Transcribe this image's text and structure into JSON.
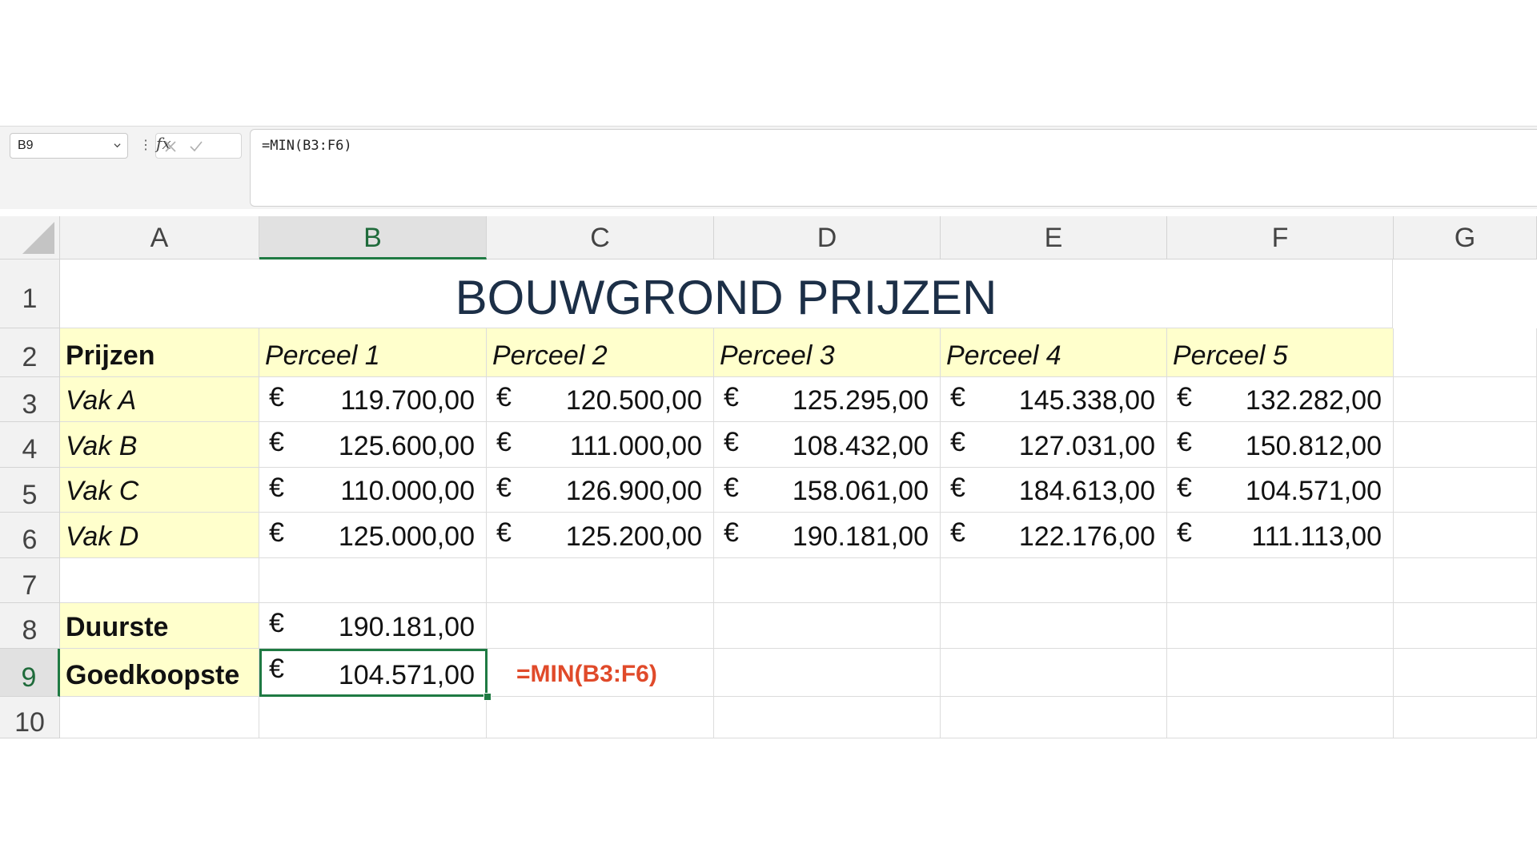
{
  "formula_bar": {
    "name_box": "B9",
    "formula": "=MIN(B3:F6)",
    "fx_label": "fx"
  },
  "columns": [
    "A",
    "B",
    "C",
    "D",
    "E",
    "F",
    "G"
  ],
  "selected_column": "B",
  "rows": [
    "1",
    "2",
    "3",
    "4",
    "5",
    "6",
    "7",
    "8",
    "9",
    "10"
  ],
  "selected_row": "9",
  "sheet": {
    "title": "BOUWGROND PRIJZEN",
    "header": {
      "label": "Prijzen",
      "parcels": [
        "Perceel 1",
        "Perceel 2",
        "Perceel 3",
        "Perceel 4",
        "Perceel 5"
      ]
    },
    "currency": "€",
    "data_rows": [
      {
        "label": "Vak A",
        "values": [
          "119.700,00",
          "120.500,00",
          "125.295,00",
          "145.338,00",
          "132.282,00"
        ]
      },
      {
        "label": "Vak B",
        "values": [
          "125.600,00",
          "111.000,00",
          "108.432,00",
          "127.031,00",
          "150.812,00"
        ]
      },
      {
        "label": "Vak C",
        "values": [
          "110.000,00",
          "126.900,00",
          "158.061,00",
          "184.613,00",
          "104.571,00"
        ]
      },
      {
        "label": "Vak D",
        "values": [
          "125.000,00",
          "125.200,00",
          "190.181,00",
          "122.176,00",
          "111.113,00"
        ]
      }
    ],
    "summary": [
      {
        "label": "Duurste",
        "value": "190.181,00"
      },
      {
        "label": "Goedkoopste",
        "value": "104.571,00"
      }
    ],
    "annotation": "=MIN(B3:F6)"
  },
  "colors": {
    "label_fill": "#ffffcc",
    "selection": "#1f7a43",
    "annotation": "#e04a2a",
    "title": "#1c2f47"
  }
}
